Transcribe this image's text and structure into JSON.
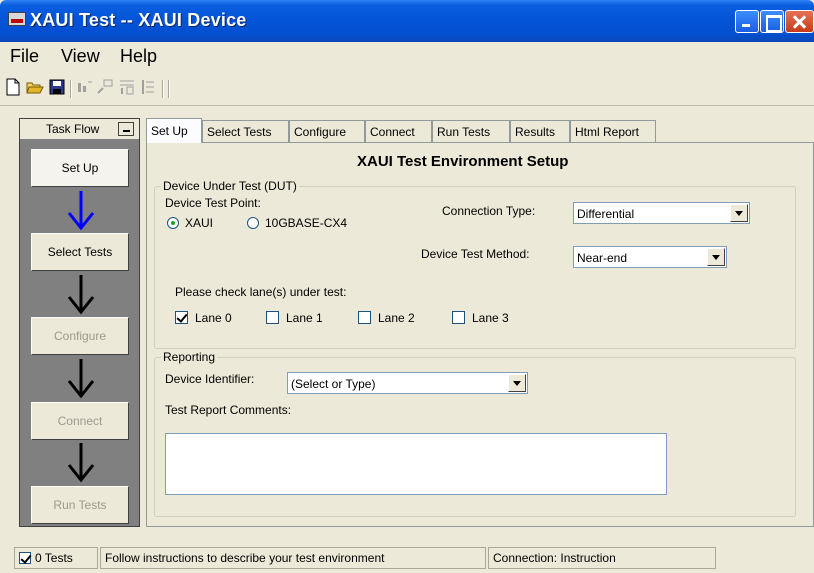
{
  "window": {
    "title": "XAUI Test -- XAUI Device"
  },
  "menu": [
    "File",
    "View",
    "Help"
  ],
  "toolbar": {
    "icons": [
      "new-icon",
      "open-icon",
      "save-icon",
      "run-icon",
      "pause-icon",
      "step-icon",
      "list-icon"
    ]
  },
  "taskflow": {
    "title": "Task Flow",
    "steps": [
      {
        "label": "Set Up",
        "state": "active"
      },
      {
        "label": "Select Tests",
        "state": "enabled"
      },
      {
        "label": "Configure",
        "state": "disabled"
      },
      {
        "label": "Connect",
        "state": "disabled"
      },
      {
        "label": "Run Tests",
        "state": "disabled"
      }
    ]
  },
  "tabs": [
    "Set Up",
    "Select Tests",
    "Configure",
    "Connect",
    "Run Tests",
    "Results",
    "Html Report"
  ],
  "setup": {
    "heading": "XAUI Test Environment Setup",
    "dut": {
      "legend": "Device Under Test (DUT)",
      "test_point_label": "Device Test Point:",
      "test_point_options": [
        "XAUI",
        "10GBASE-CX4"
      ],
      "test_point_selected": "XAUI",
      "connection_label": "Connection Type:",
      "connection_value": "Differential",
      "method_label": "Device Test Method:",
      "method_value": "Near-end",
      "lanes_label": "Please check lane(s) under test:",
      "lanes": [
        {
          "label": "Lane 0",
          "checked": true
        },
        {
          "label": "Lane 1",
          "checked": false
        },
        {
          "label": "Lane 2",
          "checked": false
        },
        {
          "label": "Lane 3",
          "checked": false
        }
      ]
    },
    "reporting": {
      "legend": "Reporting",
      "identifier_label": "Device Identifier:",
      "identifier_value": "(Select or Type)",
      "comments_label": "Test Report Comments:",
      "comments_value": ""
    }
  },
  "status": {
    "tests_count": "0 Tests",
    "tests_checked": true,
    "message": "Follow instructions to describe your test environment",
    "connection": "Connection: Instruction"
  },
  "colors": {
    "titlebar": "#0454d8",
    "window_bg": "#ece9d8",
    "flow_arrow_active": "#0000ff",
    "flow_arrow": "#000000",
    "taskflow_bg": "#808080"
  }
}
